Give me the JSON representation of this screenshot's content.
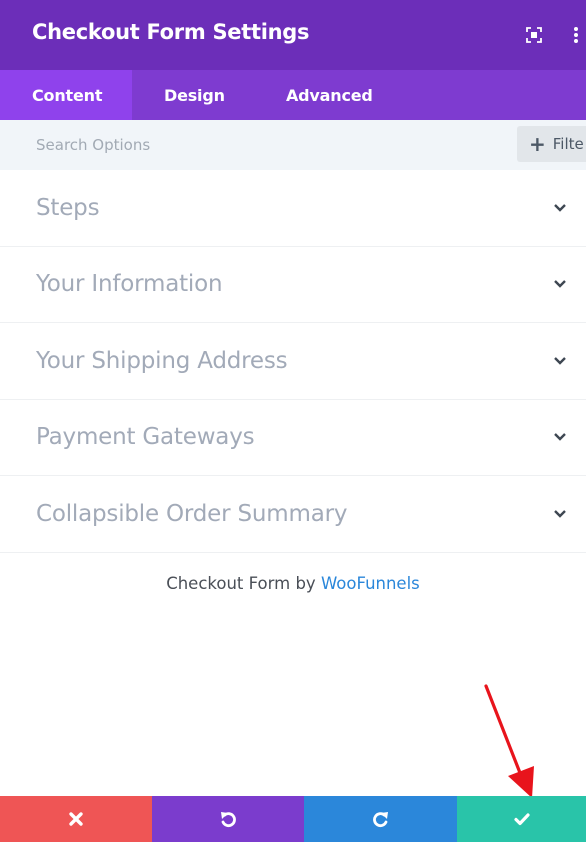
{
  "header": {
    "title": "Checkout Form Settings",
    "icons": [
      "expand-icon",
      "more-vertical-icon"
    ]
  },
  "tabs": [
    {
      "label": "Content",
      "active": true
    },
    {
      "label": "Design",
      "active": false
    },
    {
      "label": "Advanced",
      "active": false
    }
  ],
  "search": {
    "placeholder": "Search Options",
    "value": "",
    "filter_label": "Filte"
  },
  "sections": [
    {
      "title": "Steps"
    },
    {
      "title": "Your Information"
    },
    {
      "title": "Your Shipping Address"
    },
    {
      "title": "Payment Gateways"
    },
    {
      "title": "Collapsible Order Summary"
    }
  ],
  "credit": {
    "prefix": "Checkout Form by ",
    "link_text": "WooFunnels"
  },
  "footer": {
    "buttons": [
      {
        "name": "discard",
        "icon": "close-icon",
        "color": "#ef5555"
      },
      {
        "name": "undo",
        "icon": "undo-icon",
        "color": "#7b3ccd"
      },
      {
        "name": "redo",
        "icon": "redo-icon",
        "color": "#2b87da"
      },
      {
        "name": "save",
        "icon": "check-icon",
        "color": "#29c4a9"
      }
    ]
  },
  "colors": {
    "header_bg": "#6c2eb9",
    "tabs_bg": "#7e3bd0",
    "active_tab_bg": "#8f42ec",
    "link": "#2b87da",
    "annotation_arrow": "#e8141c"
  }
}
